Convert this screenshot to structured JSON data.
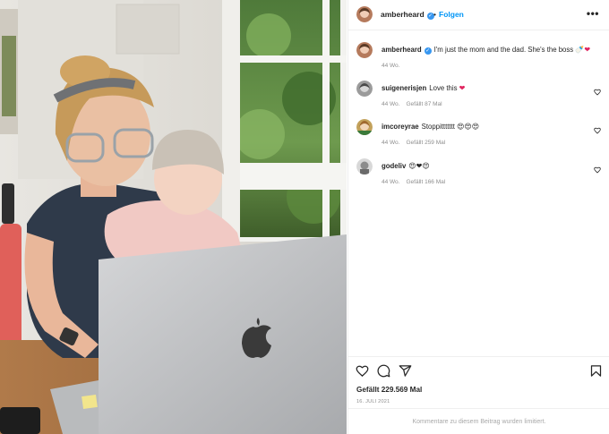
{
  "post": {
    "username": "amberheard",
    "dot": "•",
    "follow_label": "Folgen",
    "more_icon": "more-options-icon",
    "caption_text": "I'm just the mom and the dad. She's the boss",
    "caption_emoji": "🍼❤",
    "caption_time": "44 Wo."
  },
  "comments": [
    {
      "user": "suigenerisjen",
      "text": "Love this",
      "emoji": "❤",
      "time": "44 Wo.",
      "likes": "Gefällt 87 Mal"
    },
    {
      "user": "imcoreyrae",
      "text": "Stoppittttttt",
      "emoji": "😍😍😍",
      "time": "44 Wo.",
      "likes": "Gefällt 259 Mal"
    },
    {
      "user": "godeliv",
      "text": "",
      "emoji": "😍❤😍",
      "time": "44 Wo.",
      "likes": "Gefällt 166 Mal"
    }
  ],
  "actions": {
    "like_icon": "heart-icon",
    "comment_icon": "comment-icon",
    "share_icon": "share-icon",
    "save_icon": "bookmark-icon"
  },
  "likes_label": "Gefällt 229.569 Mal",
  "date_label": "16. JULI 2021",
  "comments_limited": "Kommentare zu diesem Beitrag wurden limitiert.",
  "colors": {
    "link_blue": "#0095f6",
    "verified_blue": "#3897f0",
    "heart_red": "#e0245e",
    "meta_gray": "#8e8e8e"
  }
}
